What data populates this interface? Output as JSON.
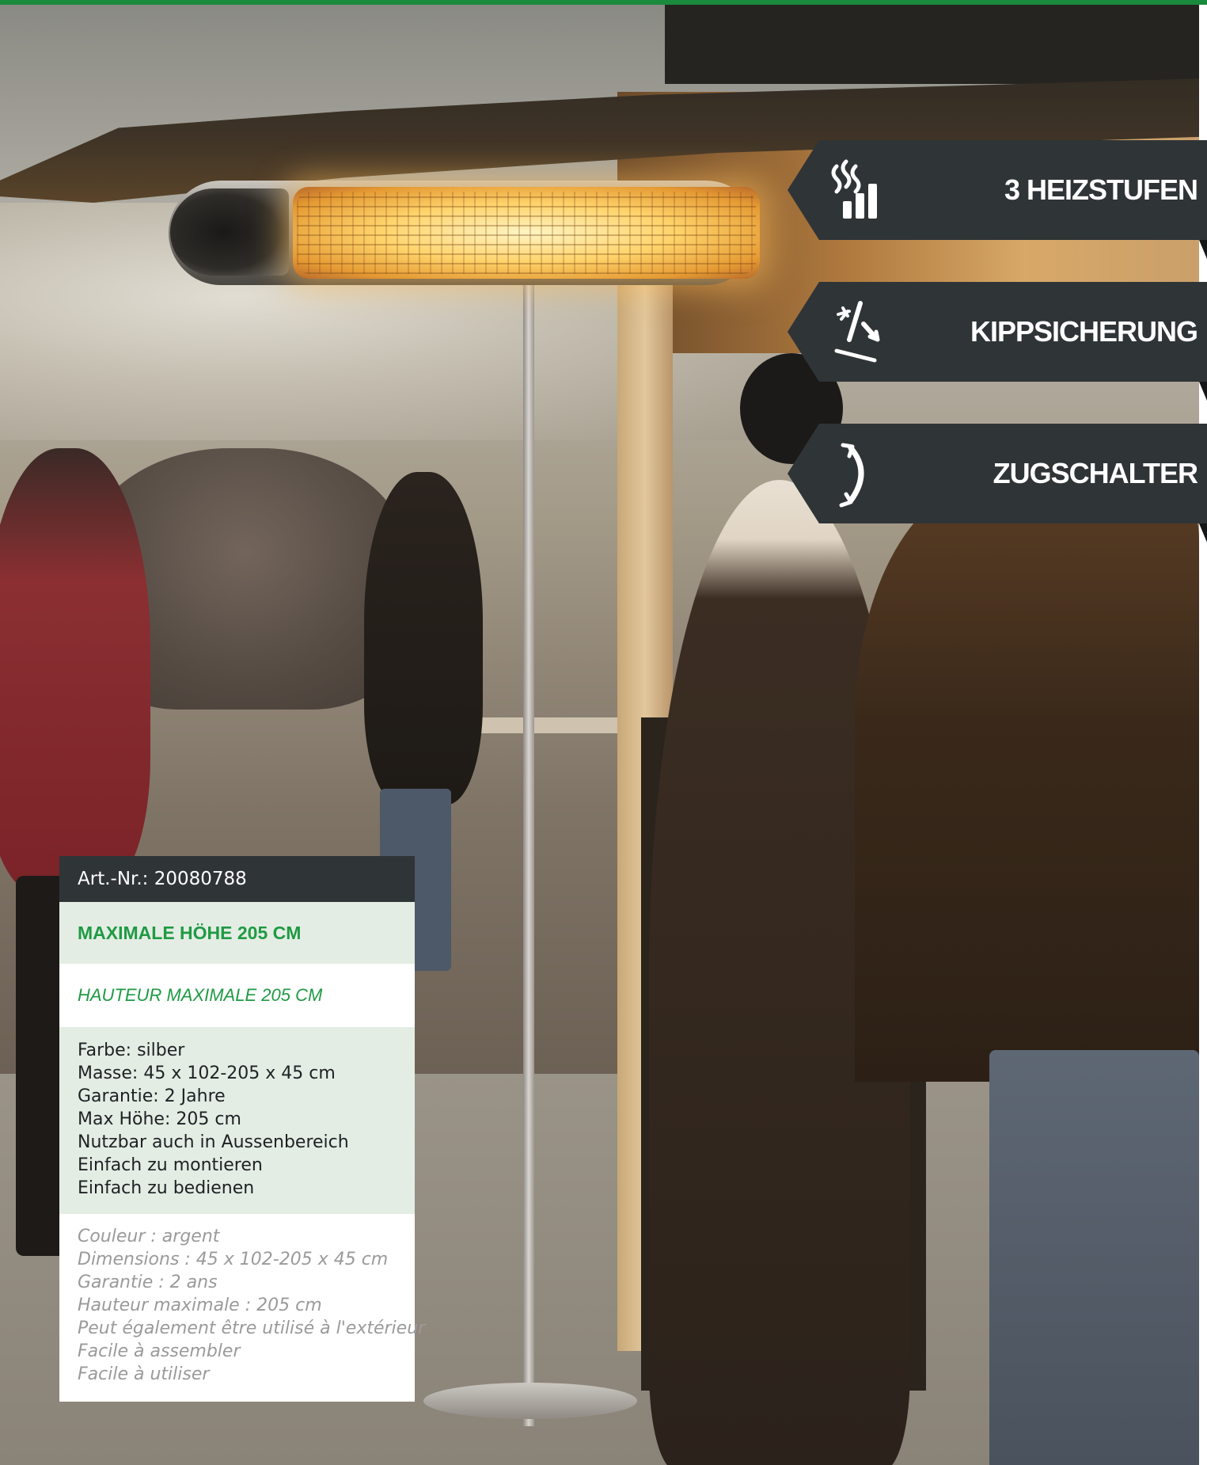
{
  "colors": {
    "brand_green": "#1a8a3c",
    "badge_dark": "#2f3437",
    "card_tint": "#e4ede4",
    "heading_green": "#1f9a44"
  },
  "features": [
    {
      "label": "3 HEIZSTUFEN",
      "icon": "heat-levels-icon"
    },
    {
      "label": "KIPPSICHERUNG",
      "icon": "tip-over-protection-icon"
    },
    {
      "label": "ZUGSCHALTER",
      "icon": "pull-switch-icon"
    }
  ],
  "product": {
    "art_nr": "Art.-Nr.: 20080788",
    "headline_de": "MAXIMALE HÖHE 205 CM",
    "headline_fr": "HAUTEUR MAXIMALE 205 CM",
    "specs_de": [
      "Farbe: silber",
      "Masse: 45 x 102-205 x 45 cm",
      "Garantie: 2 Jahre",
      "Max Höhe: 205 cm",
      "Nutzbar auch in Aussenbereich",
      "Einfach zu montieren",
      "Einfach zu bedienen"
    ],
    "specs_fr": [
      "Couleur : argent",
      "Dimensions : 45 x 102-205 x 45 cm",
      "Garantie : 2 ans",
      "Hauteur maximale : 205 cm",
      "Peut également être utilisé à l'extérieur",
      "Facile à assembler",
      "Facile à utiliser"
    ]
  }
}
